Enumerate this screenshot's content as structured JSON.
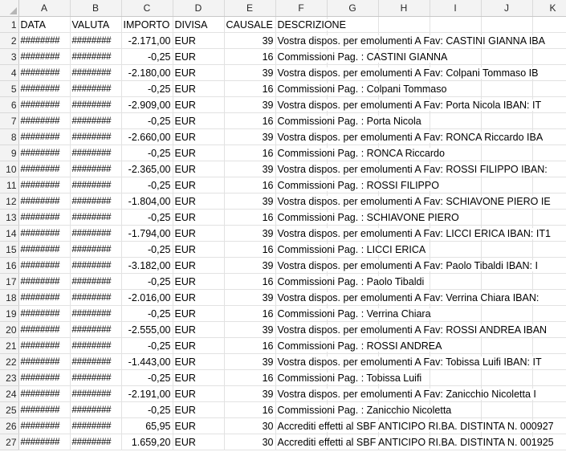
{
  "columns": [
    "A",
    "B",
    "C",
    "D",
    "E",
    "F",
    "G",
    "H",
    "I",
    "J",
    "K"
  ],
  "header_row": {
    "row_number": "1",
    "data": "DATA",
    "valuta": "VALUTA",
    "importo": "IMPORTO",
    "divisa": "DIVISA",
    "causale": "CAUSALE A",
    "descrizione": "DESCRIZIONE"
  },
  "rows": [
    {
      "n": "2",
      "data": "########",
      "valuta": "########",
      "importo": "-2.171,00",
      "divisa": "EUR",
      "causale": "39",
      "descrizione": "Vostra dispos. per emolumenti A Fav: CASTINI GIANNA IBA"
    },
    {
      "n": "3",
      "data": "########",
      "valuta": "########",
      "importo": "-0,25",
      "divisa": "EUR",
      "causale": "16",
      "descrizione": "Commissioni Pag. : CASTINI GIANNA"
    },
    {
      "n": "4",
      "data": "########",
      "valuta": "########",
      "importo": "-2.180,00",
      "divisa": "EUR",
      "causale": "39",
      "descrizione": "Vostra dispos. per emolumenti A Fav: Colpani Tommaso IB"
    },
    {
      "n": "5",
      "data": "########",
      "valuta": "########",
      "importo": "-0,25",
      "divisa": "EUR",
      "causale": "16",
      "descrizione": "Commissioni Pag. : Colpani Tommaso"
    },
    {
      "n": "6",
      "data": "########",
      "valuta": "########",
      "importo": "-2.909,00",
      "divisa": "EUR",
      "causale": "39",
      "descrizione": "Vostra dispos. per emolumenti A Fav: Porta Nicola IBAN: IT"
    },
    {
      "n": "7",
      "data": "########",
      "valuta": "########",
      "importo": "-0,25",
      "divisa": "EUR",
      "causale": "16",
      "descrizione": "Commissioni Pag. : Porta Nicola"
    },
    {
      "n": "8",
      "data": "########",
      "valuta": "########",
      "importo": "-2.660,00",
      "divisa": "EUR",
      "causale": "39",
      "descrizione": "Vostra dispos. per emolumenti A Fav: RONCA Riccardo IBA"
    },
    {
      "n": "9",
      "data": "########",
      "valuta": "########",
      "importo": "-0,25",
      "divisa": "EUR",
      "causale": "16",
      "descrizione": "Commissioni Pag. : RONCA Riccardo"
    },
    {
      "n": "10",
      "data": "########",
      "valuta": "########",
      "importo": "-2.365,00",
      "divisa": "EUR",
      "causale": "39",
      "descrizione": "Vostra dispos. per emolumenti A Fav: ROSSI FILIPPO IBAN:"
    },
    {
      "n": "11",
      "data": "########",
      "valuta": "########",
      "importo": "-0,25",
      "divisa": "EUR",
      "causale": "16",
      "descrizione": "Commissioni Pag. : ROSSI FILIPPO"
    },
    {
      "n": "12",
      "data": "########",
      "valuta": "########",
      "importo": "-1.804,00",
      "divisa": "EUR",
      "causale": "39",
      "descrizione": "Vostra dispos. per emolumenti A Fav: SCHIAVONE PIERO IE"
    },
    {
      "n": "13",
      "data": "########",
      "valuta": "########",
      "importo": "-0,25",
      "divisa": "EUR",
      "causale": "16",
      "descrizione": "Commissioni Pag. : SCHIAVONE PIERO"
    },
    {
      "n": "14",
      "data": "########",
      "valuta": "########",
      "importo": "-1.794,00",
      "divisa": "EUR",
      "causale": "39",
      "descrizione": "Vostra dispos. per emolumenti A Fav: LICCI ERICA IBAN: IT1"
    },
    {
      "n": "15",
      "data": "########",
      "valuta": "########",
      "importo": "-0,25",
      "divisa": "EUR",
      "causale": "16",
      "descrizione": "Commissioni Pag. : LICCI ERICA"
    },
    {
      "n": "16",
      "data": "########",
      "valuta": "########",
      "importo": "-3.182,00",
      "divisa": "EUR",
      "causale": "39",
      "descrizione": "Vostra dispos. per emolumenti A Fav: Paolo Tibaldi IBAN: I"
    },
    {
      "n": "17",
      "data": "########",
      "valuta": "########",
      "importo": "-0,25",
      "divisa": "EUR",
      "causale": "16",
      "descrizione": "Commissioni Pag. : Paolo Tibaldi"
    },
    {
      "n": "18",
      "data": "########",
      "valuta": "########",
      "importo": "-2.016,00",
      "divisa": "EUR",
      "causale": "39",
      "descrizione": "Vostra dispos. per emolumenti A Fav: Verrina Chiara IBAN:"
    },
    {
      "n": "19",
      "data": "########",
      "valuta": "########",
      "importo": "-0,25",
      "divisa": "EUR",
      "causale": "16",
      "descrizione": "Commissioni Pag. : Verrina Chiara"
    },
    {
      "n": "20",
      "data": "########",
      "valuta": "########",
      "importo": "-2.555,00",
      "divisa": "EUR",
      "causale": "39",
      "descrizione": "Vostra dispos. per emolumenti A Fav: ROSSI ANDREA IBAN"
    },
    {
      "n": "21",
      "data": "########",
      "valuta": "########",
      "importo": "-0,25",
      "divisa": "EUR",
      "causale": "16",
      "descrizione": "Commissioni Pag. : ROSSI ANDREA"
    },
    {
      "n": "22",
      "data": "########",
      "valuta": "########",
      "importo": "-1.443,00",
      "divisa": "EUR",
      "causale": "39",
      "descrizione": "Vostra dispos. per emolumenti A Fav: Tobissa Luifi IBAN: IT"
    },
    {
      "n": "23",
      "data": "########",
      "valuta": "########",
      "importo": "-0,25",
      "divisa": "EUR",
      "causale": "16",
      "descrizione": "Commissioni Pag. : Tobissa Luifi"
    },
    {
      "n": "24",
      "data": "########",
      "valuta": "########",
      "importo": "-2.191,00",
      "divisa": "EUR",
      "causale": "39",
      "descrizione": "Vostra dispos. per emolumenti A Fav: Zanicchio Nicoletta I"
    },
    {
      "n": "25",
      "data": "########",
      "valuta": "########",
      "importo": "-0,25",
      "divisa": "EUR",
      "causale": "16",
      "descrizione": "Commissioni Pag. : Zanicchio Nicoletta"
    },
    {
      "n": "26",
      "data": "########",
      "valuta": "########",
      "importo": "65,95",
      "divisa": "EUR",
      "causale": "30",
      "descrizione": "Accrediti effetti al SBF ANTICIPO RI.BA. DISTINTA N. 000927"
    },
    {
      "n": "27",
      "data": "########",
      "valuta": "########",
      "importo": "1.659,20",
      "divisa": "EUR",
      "causale": "30",
      "descrizione": "Accrediti effetti al SBF ANTICIPO RI.BA. DISTINTA N. 001925"
    }
  ]
}
